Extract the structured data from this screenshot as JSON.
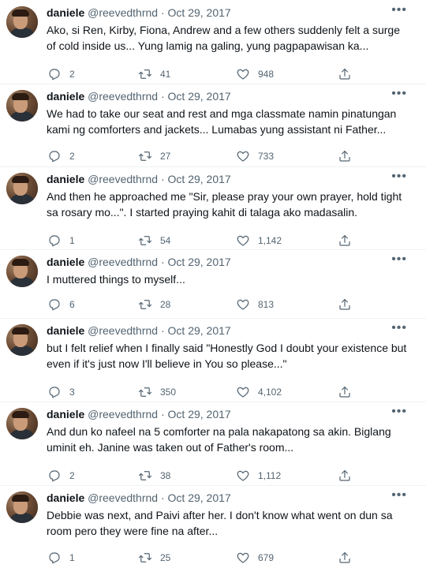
{
  "more_label": "•••",
  "tweets": [
    {
      "name": "daniele",
      "handle": "@reevedthrnd",
      "separator": "·",
      "date": "Oct 29, 2017",
      "text": "Ako, si Ren, Kirby, Fiona, Andrew and a few others suddenly felt a surge of cold inside us... Yung lamig na galing, yung pagpapawisan ka...",
      "replies": "2",
      "retweets": "41",
      "likes": "948"
    },
    {
      "name": "daniele",
      "handle": "@reevedthrnd",
      "separator": "·",
      "date": "Oct 29, 2017",
      "text": "We had to take our seat and rest and mga classmate namin pinatungan kami ng comforters and jackets... Lumabas yung assistant ni Father...",
      "replies": "2",
      "retweets": "27",
      "likes": "733"
    },
    {
      "name": "daniele",
      "handle": "@reevedthrnd",
      "separator": "·",
      "date": "Oct 29, 2017",
      "text": "And then he approached me \"Sir, please pray your own prayer, hold tight sa rosary mo...\". I started praying kahit di talaga ako madasalin.",
      "replies": "1",
      "retweets": "54",
      "likes": "1,142"
    },
    {
      "name": "daniele",
      "handle": "@reevedthrnd",
      "separator": "·",
      "date": "Oct 29, 2017",
      "text": "I muttered things to myself...",
      "replies": "6",
      "retweets": "28",
      "likes": "813"
    },
    {
      "name": "daniele",
      "handle": "@reevedthrnd",
      "separator": "·",
      "date": "Oct 29, 2017",
      "text": "but I felt relief when I finally said \"Honestly God I doubt your existence but even if it's just now I'll believe in You so please...\"",
      "replies": "3",
      "retweets": "350",
      "likes": "4,102"
    },
    {
      "name": "daniele",
      "handle": "@reevedthrnd",
      "separator": "·",
      "date": "Oct 29, 2017",
      "text": "And dun ko nafeel na 5 comforter na pala nakapatong sa akin. Biglang uminit eh. Janine was taken out of Father's room...",
      "replies": "2",
      "retweets": "38",
      "likes": "1,112"
    },
    {
      "name": "daniele",
      "handle": "@reevedthrnd",
      "separator": "·",
      "date": "Oct 29, 2017",
      "text": "Debbie was next, and Paivi after her. I don't know what went on dun sa room pero they were fine na after...",
      "replies": "1",
      "retweets": "25",
      "likes": "679"
    }
  ]
}
